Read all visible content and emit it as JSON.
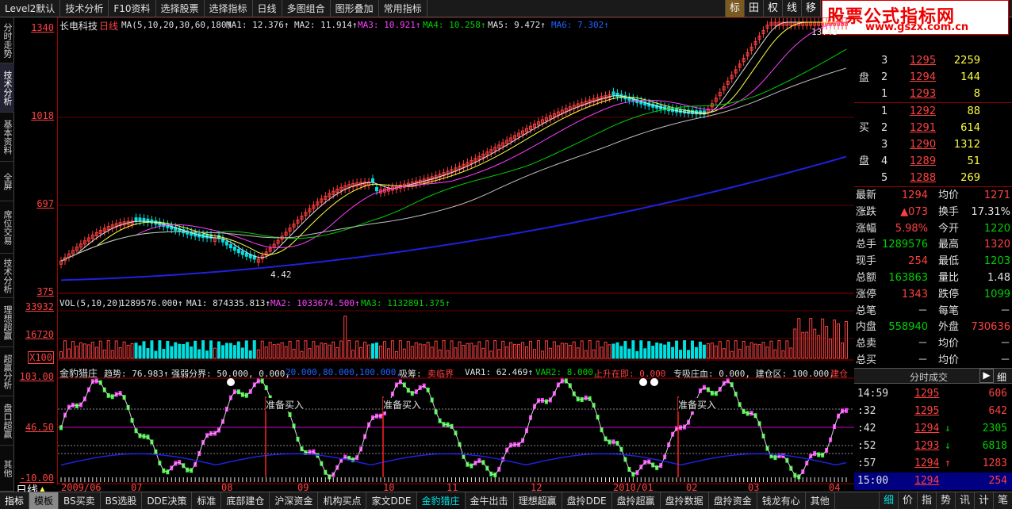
{
  "topbar": {
    "items": [
      "Level2默认",
      "技术分析",
      "F10资料",
      "选择股票",
      "选择指标",
      "日线",
      "多图组合",
      "图形叠加",
      "常用指标"
    ],
    "right_buttons": [
      "标",
      "田",
      "权",
      "线",
      "移",
      "区"
    ]
  },
  "brand": {
    "title": "股票公式指标网",
    "url": "www.gszx.com.cn"
  },
  "left_tabs": [
    "分时走势",
    "技术分析",
    "基本资料",
    "全屏",
    "席位交易",
    "技术分析",
    "理想超赢",
    "超赢分析",
    "盘口超赢",
    "其他"
  ],
  "main_chart": {
    "stock_name": "长电科技",
    "period": "日线",
    "ma_label": "MA(5,10,20,30,60,180)",
    "ma1": "MA1: 12.376↑",
    "ma2": "MA2: 11.914↑",
    "ma3": "MA3: 10.921↑",
    "ma4": "MA4: 10.258↑",
    "ma5": "MA5: 9.472↑",
    "ma6": "MA6: 7.302↑",
    "y_labels": [
      "1340",
      "1018",
      "697",
      "375"
    ],
    "low_marker": "4.42",
    "high_marker": "13.43"
  },
  "volume": {
    "label": "VOL(5,10,20)",
    "value": "1289576.000↑",
    "ma1": "MA1: 874335.813↑",
    "ma2": "MA2: 1033674.500↑",
    "ma3": "MA3: 1132891.375↑",
    "y_labels": [
      "33932",
      "16720"
    ],
    "unit": "X100"
  },
  "indicator": {
    "name": "金豹猎庄",
    "trend": "趋势: 76.983↑",
    "strong": "强弱分界: 50.000, 0.000,",
    "v20": "20.000,",
    "v80": "80.000,",
    "v100": "100.000,",
    "absorb": "吸筹:",
    "sell_line": "卖临界",
    "var1": "VAR1: 62.469↑",
    "var2": "VAR2: 8.000,",
    "up_start": "上升在即: 0.000",
    "exclusive": "专吸庄血: 0.000, 建仓区: 100.000,",
    "build": "建仓",
    "prepare_buy": "准备买入",
    "y_labels": [
      "103.00",
      "46.50",
      "-10.00"
    ]
  },
  "x_labels": [
    "2009/06",
    "07",
    "08",
    "09",
    "10",
    "11",
    "12",
    "2010/01",
    "02",
    "03",
    "04"
  ],
  "day_label": "日线",
  "order_book": {
    "sell": [
      {
        "lvl": "3",
        "price": "1295",
        "vol": "2259"
      },
      {
        "lvl": "2",
        "price": "1294",
        "vol": "144"
      },
      {
        "lvl": "1",
        "price": "1293",
        "vol": "8"
      }
    ],
    "buy": [
      {
        "lvl": "1",
        "price": "1292",
        "vol": "88"
      },
      {
        "lvl": "2",
        "price": "1291",
        "vol": "614"
      },
      {
        "lvl": "3",
        "price": "1290",
        "vol": "1312"
      },
      {
        "lvl": "4",
        "price": "1289",
        "vol": "51"
      },
      {
        "lvl": "5",
        "price": "1288",
        "vol": "269"
      }
    ],
    "sell_label": [
      "盘"
    ],
    "buy_label": [
      "买",
      "盘"
    ]
  },
  "stats": [
    {
      "l1": "最新",
      "v1": "1294",
      "l2": "均价",
      "v2": "1271"
    },
    {
      "l1": "涨跌",
      "v1": "▲073",
      "l2": "换手",
      "v2": "17.31%"
    },
    {
      "l1": "涨幅",
      "v1": "5.98%",
      "l2": "今开",
      "v2": "1220"
    },
    {
      "l1": "总手",
      "v1": "1289576",
      "l2": "最高",
      "v2": "1320"
    },
    {
      "l1": "现手",
      "v1": "254",
      "l2": "最低",
      "v2": "1203"
    },
    {
      "l1": "总额",
      "v1": "163863",
      "l2": "量比",
      "v2": "1.48"
    },
    {
      "l1": "涨停",
      "v1": "1343",
      "l2": "跌停",
      "v2": "1099"
    },
    {
      "l1": "总笔",
      "v1": "－",
      "l2": "每笔",
      "v2": "－"
    },
    {
      "l1": "内盘",
      "v1": "558940",
      "l2": "外盘",
      "v2": "730636"
    },
    {
      "l1": "总卖",
      "v1": "－",
      "l2": "均价",
      "v2": "－"
    },
    {
      "l1": "总买",
      "v1": "－",
      "l2": "均价",
      "v2": "－"
    }
  ],
  "ticks": {
    "title": "分时成交",
    "rows": [
      {
        "t": "14:59",
        "p": "1295",
        "arrow": "",
        "v": "606"
      },
      {
        "t": ":32",
        "p": "1295",
        "arrow": "",
        "v": "642"
      },
      {
        "t": ":42",
        "p": "1294",
        "arrow": "↓",
        "v": "2305"
      },
      {
        "t": ":52",
        "p": "1293",
        "arrow": "↓",
        "v": "6818"
      },
      {
        "t": ":57",
        "p": "1294",
        "arrow": "↑",
        "v": "1283"
      },
      {
        "t": "15:00",
        "p": "1294",
        "arrow": "",
        "v": "254"
      }
    ]
  },
  "bottombar": {
    "items": [
      "指标",
      "模板",
      "BS买卖",
      "BS选股",
      "DDE决策",
      "标准",
      "底部建仓",
      "沪深资金",
      "机构买点",
      "家文DDE",
      "金豹猎庄",
      "金牛出击",
      "理想超赢",
      "盘拎DDE",
      "盘拎超赢",
      "盘拎数据",
      "盘拎资金",
      "钱龙有心",
      "其他"
    ],
    "right_nav": [
      "细",
      "价",
      "指",
      "势",
      "讯",
      "计",
      "笔"
    ]
  },
  "colors": {
    "red": "#ff4040",
    "green": "#00d000",
    "magenta": "#ff40ff",
    "yellow": "#ffff40",
    "blue": "#2020e0"
  }
}
